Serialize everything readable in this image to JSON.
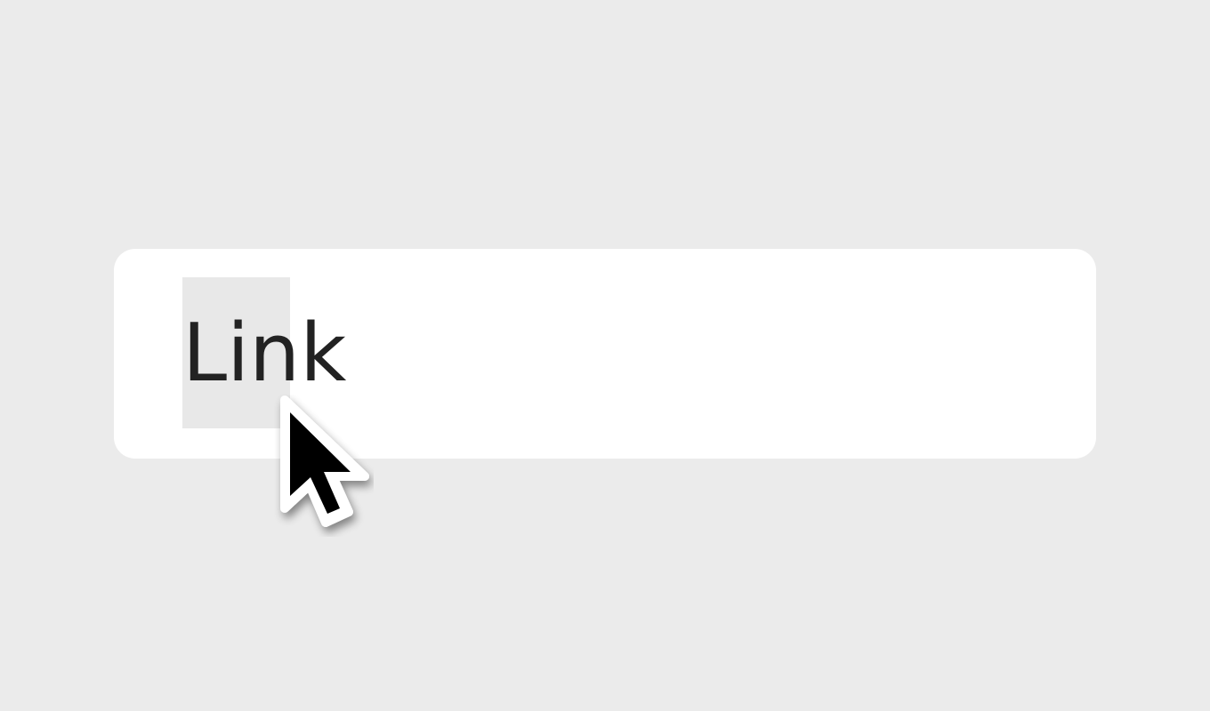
{
  "link": {
    "label": "Link"
  },
  "selection": {
    "selected_text": "Lin",
    "highlight_color": "#e8e8e8"
  },
  "cursor": {
    "icon": "arrow-pointer-icon",
    "fill": "#000000",
    "outline": "#ffffff"
  },
  "colors": {
    "background": "#ebebeb",
    "card": "#ffffff",
    "text": "#222222"
  }
}
